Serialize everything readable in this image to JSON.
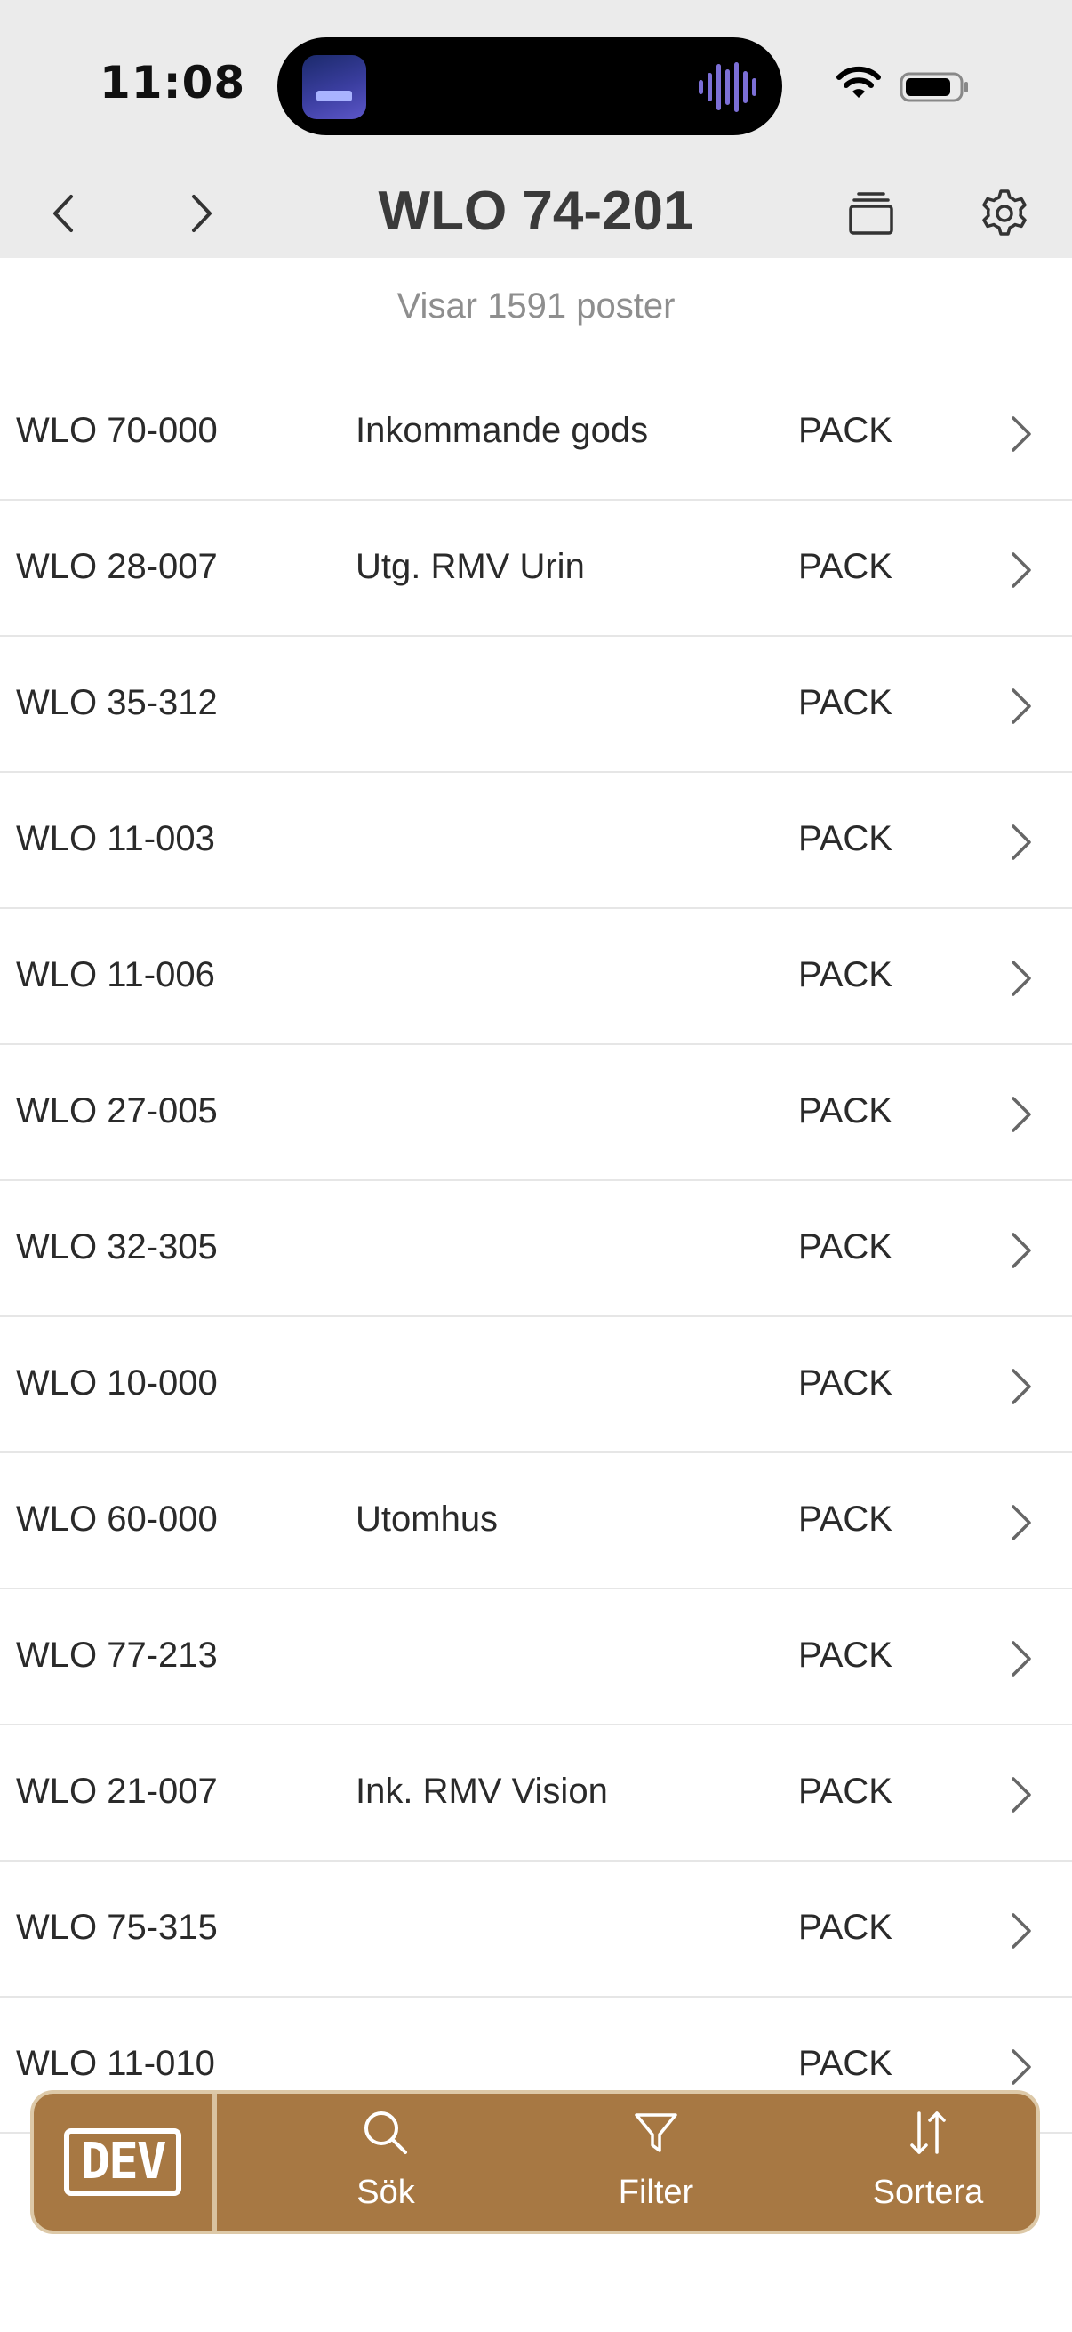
{
  "status": {
    "time": "11:08"
  },
  "nav": {
    "title": "WLO 74-201"
  },
  "list": {
    "count_label": "Visar 1591 poster",
    "rows": [
      {
        "code": "WLO 70-000",
        "desc": "Inkommande gods",
        "type": "PACK"
      },
      {
        "code": "WLO 28-007",
        "desc": "Utg. RMV Urin",
        "type": "PACK"
      },
      {
        "code": "WLO 35-312",
        "desc": "",
        "type": "PACK"
      },
      {
        "code": "WLO 11-003",
        "desc": "",
        "type": "PACK"
      },
      {
        "code": "WLO 11-006",
        "desc": "",
        "type": "PACK"
      },
      {
        "code": "WLO 27-005",
        "desc": "",
        "type": "PACK"
      },
      {
        "code": "WLO 32-305",
        "desc": "",
        "type": "PACK"
      },
      {
        "code": "WLO 10-000",
        "desc": "",
        "type": "PACK"
      },
      {
        "code": "WLO 60-000",
        "desc": "Utomhus",
        "type": "PACK"
      },
      {
        "code": "WLO 77-213",
        "desc": "",
        "type": "PACK"
      },
      {
        "code": "WLO 21-007",
        "desc": "Ink. RMV Vision",
        "type": "PACK"
      },
      {
        "code": "WLO 75-315",
        "desc": "",
        "type": "PACK"
      },
      {
        "code": "WLO 11-010",
        "desc": "",
        "type": "PACK"
      }
    ]
  },
  "toolbar": {
    "logo_text": "DEV",
    "search_label": "Sök",
    "filter_label": "Filter",
    "sort_label": "Sortera"
  },
  "colors": {
    "toolbar_bg": "#a77843",
    "toolbar_border": "#ddc9a8",
    "nav_bg": "#ebebeb"
  }
}
